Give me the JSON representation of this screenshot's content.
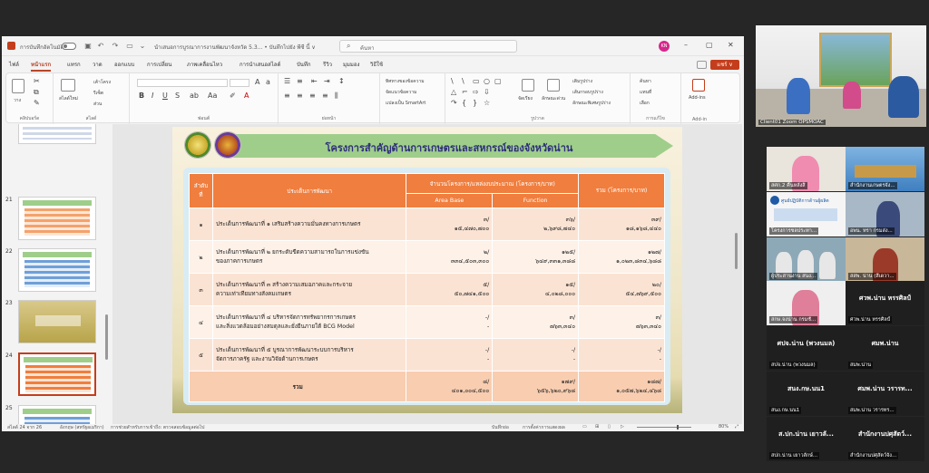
{
  "ppt": {
    "autosave_label": "การบันทึกอัตโนมัติ",
    "doc_title": "นำเสนอการบูรณาการงานพัฒนาจังหวัด 5.3... • บันทึกไปยัง พีซี นี้ ∨",
    "search_placeholder": "ค้นหา",
    "avatar_initials": "KN",
    "share_label": "แชร์ ∨",
    "tabs": [
      "ไฟล์",
      "หน้าแรก",
      "แทรก",
      "วาด",
      "ออกแบบ",
      "การเปลี่ยน",
      "ภาพเคลื่อนไหว",
      "การนำเสนอสไลด์",
      "บันทึก",
      "รีวิว",
      "มุมมอง",
      "วิธีใช้"
    ],
    "ribbon": {
      "clipboard": "คลิปบอร์ด",
      "paste": "วาง",
      "new_slide": "สไลด์ใหม่",
      "slides": "สไลด์",
      "layout": "เค้าโครง",
      "reset": "รีเซ็ต",
      "section": "ส่วน",
      "font": "ฟอนต์",
      "paragraph": "ย่อหน้า",
      "text_direction": "ทิศทางของข้อความ",
      "align_text": "จัดแนวข้อความ",
      "smartart": "แปลงเป็น SmartArt",
      "arrange": "จัดเรียง",
      "quick_styles": "ลักษณะด่วน",
      "shape_fill": "เติมรูปร่าง",
      "shape_outline": "เส้นกรอบรูปร่าง",
      "shape_effects": "ลักษณะพิเศษรูปร่าง",
      "drawing": "รูปวาด",
      "find": "ค้นหา",
      "replace": "แทนที่",
      "select": "เลือก",
      "editing": "การแก้ไข",
      "addins": "Add-ins",
      "addins_group": "Add-in"
    },
    "thumbnails": [
      {
        "num": "",
        "kind": "table"
      },
      {
        "num": "21",
        "kind": "table"
      },
      {
        "num": "22",
        "kind": "table"
      },
      {
        "num": "23",
        "kind": "photo"
      },
      {
        "num": "24",
        "kind": "table",
        "selected": true
      },
      {
        "num": "25",
        "kind": "table"
      }
    ],
    "status": {
      "slide_of": "สไลด์ 24 จาก 26",
      "language": "อังกฤษ (สหรัฐอเมริกา)",
      "accessibility": "การช่วยสำหรับการเข้าถึง: ตรวจสอบข้อมูลต่อไป",
      "notes": "บันทึกย่อ",
      "display_settings": "การตั้งค่าการแสดงผล",
      "zoom": "80%"
    }
  },
  "slide": {
    "title": "โครงการสำคัญด้านการเกษตรและสหกรณ์ของจังหวัดน่าน",
    "table": {
      "headers": {
        "no": "ลำดับ ที่",
        "topic": "ประเด็นการพัฒนา",
        "group": "จำนวนโครงการ/แหล่งงบประมาณ (โครงการ/บาท)",
        "area": "Area Base",
        "func": "Function",
        "total": "รวม (โครงการ/บาท)"
      },
      "rows": [
        {
          "no": "๑",
          "topic": [
            "ประเด็นการพัฒนาที่ ๑ เสริมสร้างความมั่นคงทางการเกษตร",
            ""
          ],
          "area": [
            "๓/",
            "๑๕,๔๗๐,๗๐๐"
          ],
          "func": [
            "๓๖/",
            "๒,๖๙๘,๗๔๐"
          ],
          "total": [
            "๓๙/",
            "๑๘,๑๖๘,๔๔๐"
          ]
        },
        {
          "no": "๒",
          "topic": [
            "ประเด็นการพัฒนาที่ ๒ ยกระดับขีดความสามารถในการแข่งขัน",
            "ของภาคการเกษตร"
          ],
          "area": [
            "๒/",
            "๓๓๔,๕๐๓,๓๐๐"
          ],
          "func": [
            "๑๒๕/",
            "๖๔๙,๓๓๑,๓๘๘"
          ],
          "total": [
            "๑๒๗/",
            "๑,๐๒๓,๘๓๔,๖๘๘"
          ]
        },
        {
          "no": "๓",
          "topic": [
            "ประเด็นการพัฒนาที่ ๓ สร้างความเสมอภาคและกระจาย",
            "ความเท่าเทียมทางสังคมเกษตร"
          ],
          "area": [
            "๕/",
            "๕๐,๗๔๑,๕๐๐"
          ],
          "func": [
            "๑๕/",
            "๔,๐๒๘,๐๐๐"
          ],
          "total": [
            "๒๐/",
            "๕๔,๗๖๙,๕๐๐"
          ]
        },
        {
          "no": "๔",
          "topic": [
            "ประเด็นการพัฒนาที่ ๔ บริหารจัดการทรัพยากรการเกษตร",
            "และสิ่งแวดล้อมอย่างสมดุลและยั่งยืนภายใต้ BCG Model"
          ],
          "area": [
            "-/",
            "-"
          ],
          "func": [
            "๓/",
            "๗๖๓,๓๔๐"
          ],
          "total": [
            "๓/",
            "๗๖๓,๓๔๐"
          ]
        },
        {
          "no": "๕",
          "topic": [
            "ประเด็นการพัฒนาที่ ๕ บูรณาการพัฒนาระบบการบริหาร",
            "จัดการภาครัฐ และงานวิจัยด้านการเกษตร"
          ],
          "area": [
            "-/",
            "-"
          ],
          "func": [
            "-/",
            "-"
          ],
          "total": [
            "-/",
            "-"
          ]
        }
      ],
      "total_row": {
        "label": "รวม",
        "area": [
          "๘/",
          "๔๐๑,๐๐๔,๕๐๐"
        ],
        "func": [
          "๑๗๙/",
          "๖๕๖,๖๒๐,๙๖๘"
        ],
        "total": [
          "๑๘๗/",
          "๑,๐๕๗,๖๒๔,๔๖๘"
        ]
      }
    }
  },
  "meeting": {
    "main_tile_name": "Client01 Zoom OPSMOAC",
    "tiles": [
      {
        "name": "สศก.2 คืนหลังสิ",
        "kind": "person"
      },
      {
        "name": "สำนักงานเกษตรจัง...",
        "kind": "photo"
      },
      {
        "name": "โครงการชลประทา...",
        "kind": "logo",
        "header": "ศูนย์ปฏิบัติการด้านผู้ผลิต"
      },
      {
        "name": "อพน. ทรา กรมส่ง...",
        "kind": "person"
      },
      {
        "name": "ผู้ประสานงาน สนง...",
        "kind": "group"
      },
      {
        "name": "สสพ. น่าน (สีเดวา...",
        "kind": "person"
      },
      {
        "name": "สกษ.จงน่าน กรมชั...",
        "kind": "person"
      },
      {
        "name": "ศวพ.น่าน หรรศิลป์",
        "kind": "text",
        "big": "ศวพ.น่าน หรรศิลป์"
      },
      {
        "name": "สปจ.น่าน (พวงนมล)",
        "kind": "text",
        "big": "ศปจ.น่าน (พวงนมล)"
      },
      {
        "name": "สมพ.น่าน",
        "kind": "text",
        "big": "ศมพ.น่าน"
      },
      {
        "name": "สนง.กษ.นน1",
        "kind": "text",
        "big": "สนง.กษ.นน1"
      },
      {
        "name": "สมพ.น่าน วรารทร...",
        "kind": "text",
        "big": "ศมพ.น่าน วรารท..."
      },
      {
        "name": "สปก.น่าน เยาวลักษ์...",
        "kind": "text",
        "big": "ส.ปก.น่าน เยาวลั..."
      },
      {
        "name": "สำนักงานปศุสัตว์จัง...",
        "kind": "text",
        "big": "สำนักงานปศุสัตว์..."
      }
    ]
  }
}
